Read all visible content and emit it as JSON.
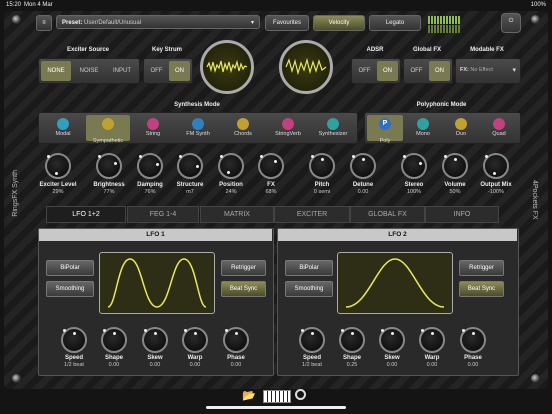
{
  "status": {
    "time": "15:20",
    "date": "Mon 4 Mar",
    "battery": "100%"
  },
  "header": {
    "preset_label": "Preset:",
    "preset_value": "User/Default/Unusual",
    "favourites": "Favourites",
    "velocity": "Velocity",
    "legato": "Legato"
  },
  "side": {
    "left": "RingsFX Synth",
    "right": "4Pockets FX"
  },
  "exciter_source": {
    "title": "Exciter Source",
    "options": [
      "NONE",
      "NOISE",
      "INPUT"
    ],
    "selected": "NONE"
  },
  "key_strum": {
    "title": "Key Strum",
    "options": [
      "OFF",
      "ON"
    ],
    "selected": "ON"
  },
  "adsr": {
    "title": "ADSR",
    "options": [
      "OFF",
      "ON"
    ],
    "selected": "ON"
  },
  "global_fx": {
    "title": "Global FX",
    "options": [
      "OFF",
      "ON"
    ],
    "selected": "ON"
  },
  "modable_fx": {
    "title": "Modable FX",
    "label": "FX:",
    "value": "No Effect"
  },
  "synthesis_mode": {
    "title": "Synthesis Mode",
    "items": [
      "Modal",
      "Sympathetic",
      "String",
      "FM Synth",
      "Chords",
      "StringVerb",
      "Synthesizer"
    ],
    "selected": "Sympathetic",
    "colors": [
      "#2fa0c0",
      "#c0a030",
      "#c04080",
      "#3080c0",
      "#c0a030",
      "#c04080",
      "#30a0a0"
    ]
  },
  "polyphonic_mode": {
    "title": "Polyphonic Mode",
    "items": [
      "Poly",
      "Mono",
      "Duo",
      "Quad"
    ],
    "selected": "Poly",
    "icon_letters": [
      "P",
      "",
      "",
      ""
    ],
    "colors": [
      "#3070c0",
      "#30a0a0",
      "#c0a030",
      "#c04080"
    ]
  },
  "knobs": [
    {
      "label": "Exciter Level",
      "value": "29%"
    },
    {
      "label": "Brightness",
      "value": "77%"
    },
    {
      "label": "Damping",
      "value": "76%"
    },
    {
      "label": "Structure",
      "value": "m7"
    },
    {
      "label": "Position",
      "value": "24%"
    },
    {
      "label": "FX",
      "value": "68%"
    },
    {
      "label": "Pitch",
      "value": "0 semi"
    },
    {
      "label": "Detune",
      "value": "0.00"
    },
    {
      "label": "Stereo",
      "value": "100%"
    },
    {
      "label": "Volume",
      "value": "50%"
    },
    {
      "label": "Output Mix",
      "value": "-100%"
    }
  ],
  "tabs": {
    "items": [
      "LFO 1+2",
      "FEG 1-4",
      "MATRIX",
      "EXCITER",
      "GLOBAL FX",
      "INFO"
    ],
    "selected": "LFO 1+2"
  },
  "lfo1": {
    "title": "LFO 1",
    "bipolar": "BiPolar",
    "smoothing": "Smoothing",
    "retrigger": "Retrigger",
    "beat_sync": "Beat Sync",
    "knobs": [
      {
        "label": "Speed",
        "value": "1/2 beat"
      },
      {
        "label": "Shape",
        "value": "0.00"
      },
      {
        "label": "Skew",
        "value": "0.00"
      },
      {
        "label": "Warp",
        "value": "0.00"
      },
      {
        "label": "Phase",
        "value": "0.00"
      }
    ]
  },
  "lfo2": {
    "title": "LFO 2",
    "bipolar": "BiPolar",
    "smoothing": "Smoothing",
    "retrigger": "Retrigger",
    "beat_sync": "Beat Sync",
    "knobs": [
      {
        "label": "Speed",
        "value": "1/2 beat"
      },
      {
        "label": "Shape",
        "value": "0.25"
      },
      {
        "label": "Skew",
        "value": "0.00"
      },
      {
        "label": "Warp",
        "value": "0.00"
      },
      {
        "label": "Phase",
        "value": "0.00"
      }
    ]
  },
  "colors": {
    "accent": "#7a7a52",
    "wave": "#e8e860"
  },
  "dock_icons": [
    "folder-icon",
    "keyboard-icon",
    "midi-icon"
  ]
}
